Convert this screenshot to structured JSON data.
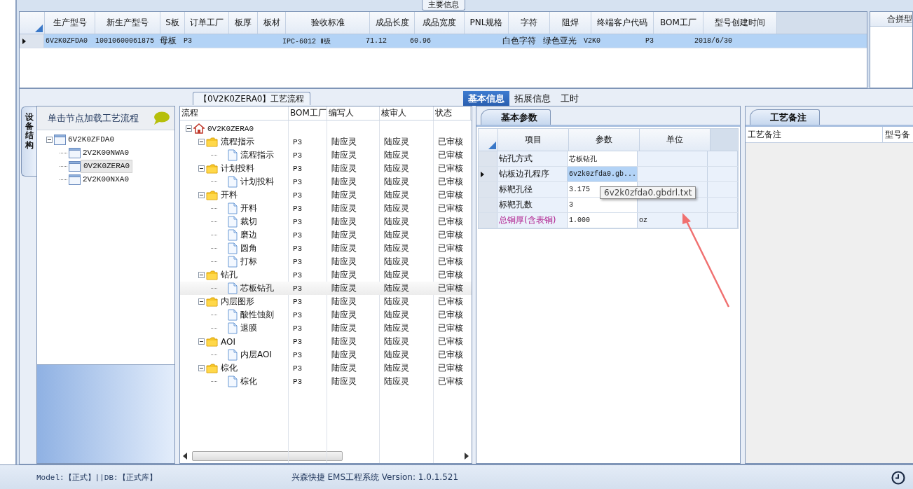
{
  "main_info": {
    "title": "主要信息",
    "columns": [
      "生产型号",
      "新生产型号",
      "S板",
      "订单工厂",
      "板厚",
      "板材",
      "验收标准",
      "成品长度",
      "成品宽度",
      "PNL规格",
      "字符",
      "阻焊",
      "终端客户代码",
      "BOM工厂",
      "型号创建时间"
    ],
    "rows": [
      {
        "current": true,
        "selected": true,
        "cells": [
          "6V2K0ZFDA0",
          "10010600061875",
          "母板",
          "P3",
          null,
          null,
          "IPC-6012 Ⅱ级",
          "71.12",
          "60.96",
          null,
          "白色字符",
          "绿色亚光",
          "V2K0",
          "P3",
          "2018/6/30"
        ]
      }
    ]
  },
  "merge_panel": {
    "title": "合拼型"
  },
  "device_panel": {
    "tab": "设备结构",
    "hint": "单击节点加载工艺流程",
    "tree": {
      "label": "6V2K0ZFDA0",
      "expanded": true,
      "selected": false,
      "children": [
        {
          "label": "2V2K00NWA0",
          "selected": false
        },
        {
          "label": "0V2K0ZERA0",
          "selected": true
        },
        {
          "label": "2V2K00NXA0",
          "selected": false
        }
      ]
    }
  },
  "process_panel": {
    "title": "【0V2K0ZERA0】工艺流程",
    "columns": [
      "流程",
      "BOM工厂",
      "编写人",
      "核审人",
      "状态"
    ],
    "tree": [
      {
        "kind": "root",
        "label": "0V2K0ZERA0",
        "expanded": true,
        "selected": false,
        "children": [
          {
            "kind": "folder",
            "label": "流程指示",
            "bom": "P3",
            "author": "陆应灵",
            "reviewer": "陆应灵",
            "status": "已审核",
            "expanded": true,
            "selected": false,
            "children": [
              {
                "kind": "document",
                "label": "流程指示",
                "bom": "P3",
                "author": "陆应灵",
                "reviewer": "陆应灵",
                "status": "已审核",
                "selected": false
              }
            ]
          },
          {
            "kind": "folder",
            "label": "计划投料",
            "bom": "P3",
            "author": "陆应灵",
            "reviewer": "陆应灵",
            "status": "已审核",
            "expanded": true,
            "selected": false,
            "children": [
              {
                "kind": "document",
                "label": "计划投料",
                "bom": "P3",
                "author": "陆应灵",
                "reviewer": "陆应灵",
                "status": "已审核",
                "selected": false
              }
            ]
          },
          {
            "kind": "folder",
            "label": "开料",
            "bom": "P3",
            "author": "陆应灵",
            "reviewer": "陆应灵",
            "status": "已审核",
            "expanded": true,
            "selected": false,
            "children": [
              {
                "kind": "document",
                "label": "开料",
                "bom": "P3",
                "author": "陆应灵",
                "reviewer": "陆应灵",
                "status": "已审核",
                "selected": false
              },
              {
                "kind": "document",
                "label": "裁切",
                "bom": "P3",
                "author": "陆应灵",
                "reviewer": "陆应灵",
                "status": "已审核",
                "selected": false
              },
              {
                "kind": "document",
                "label": "磨边",
                "bom": "P3",
                "author": "陆应灵",
                "reviewer": "陆应灵",
                "status": "已审核",
                "selected": false
              },
              {
                "kind": "document",
                "label": "圆角",
                "bom": "P3",
                "author": "陆应灵",
                "reviewer": "陆应灵",
                "status": "已审核",
                "selected": false
              },
              {
                "kind": "document",
                "label": "打标",
                "bom": "P3",
                "author": "陆应灵",
                "reviewer": "陆应灵",
                "status": "已审核",
                "selected": false
              }
            ]
          },
          {
            "kind": "folder",
            "label": "钻孔",
            "bom": "P3",
            "author": "陆应灵",
            "reviewer": "陆应灵",
            "status": "已审核",
            "expanded": true,
            "selected": false,
            "children": [
              {
                "kind": "document",
                "label": "芯板钻孔",
                "bom": "P3",
                "author": "陆应灵",
                "reviewer": "陆应灵",
                "status": "已审核",
                "selected": true
              }
            ]
          },
          {
            "kind": "folder",
            "label": "内层图形",
            "bom": "P3",
            "author": "陆应灵",
            "reviewer": "陆应灵",
            "status": "已审核",
            "expanded": true,
            "selected": false,
            "children": [
              {
                "kind": "document",
                "label": "酸性蚀刻",
                "bom": "P3",
                "author": "陆应灵",
                "reviewer": "陆应灵",
                "status": "已审核",
                "selected": false
              },
              {
                "kind": "document",
                "label": "退膜",
                "bom": "P3",
                "author": "陆应灵",
                "reviewer": "陆应灵",
                "status": "已审核",
                "selected": false
              }
            ]
          },
          {
            "kind": "folder",
            "label": "AOI",
            "bom": "P3",
            "author": "陆应灵",
            "reviewer": "陆应灵",
            "status": "已审核",
            "expanded": true,
            "selected": false,
            "children": [
              {
                "kind": "document",
                "label": "内层AOI",
                "bom": "P3",
                "author": "陆应灵",
                "reviewer": "陆应灵",
                "status": "已审核",
                "selected": false
              }
            ]
          },
          {
            "kind": "folder",
            "label": "棕化",
            "bom": "P3",
            "author": "陆应灵",
            "reviewer": "陆应灵",
            "status": "已审核",
            "expanded": true,
            "selected": false,
            "children": [
              {
                "kind": "document",
                "label": "棕化",
                "bom": "P3",
                "author": "陆应灵",
                "reviewer": "陆应灵",
                "status": "已审核",
                "selected": false
              }
            ]
          }
        ]
      }
    ]
  },
  "detail_tabs": [
    {
      "label": "基本信息",
      "selected": true
    },
    {
      "label": "拓展信息",
      "selected": false
    },
    {
      "label": "工时",
      "selected": false
    }
  ],
  "params": {
    "tab": "基本参数",
    "columns": [
      "项目",
      "参数",
      "单位"
    ],
    "rows": [
      {
        "current": false,
        "emphasized": false,
        "cells": [
          "钻孔方式",
          "芯板钻孔",
          null
        ]
      },
      {
        "current": true,
        "emphasized": false,
        "cells": [
          "钻板边孔程序",
          "6v2k0zfda0.gb...",
          null
        ]
      },
      {
        "current": false,
        "emphasized": false,
        "cells": [
          "标靶孔径",
          "3.175",
          null
        ]
      },
      {
        "current": false,
        "emphasized": false,
        "cells": [
          "标靶孔数",
          "3",
          null
        ]
      },
      {
        "current": false,
        "emphasized": true,
        "cells": [
          "总铜厚(含表铜)",
          "1.000",
          "oz"
        ]
      }
    ]
  },
  "tooltip": "6v2k0zfda0.gbdrl.txt",
  "notes": {
    "tab": "工艺备注",
    "columns": [
      "工艺备注",
      "型号备"
    ]
  },
  "status_bar": {
    "connection": "Model:【正式】||DB:【正式库】",
    "system": "兴森快捷 EMS工程系统 Version: 1.0.1.521"
  }
}
